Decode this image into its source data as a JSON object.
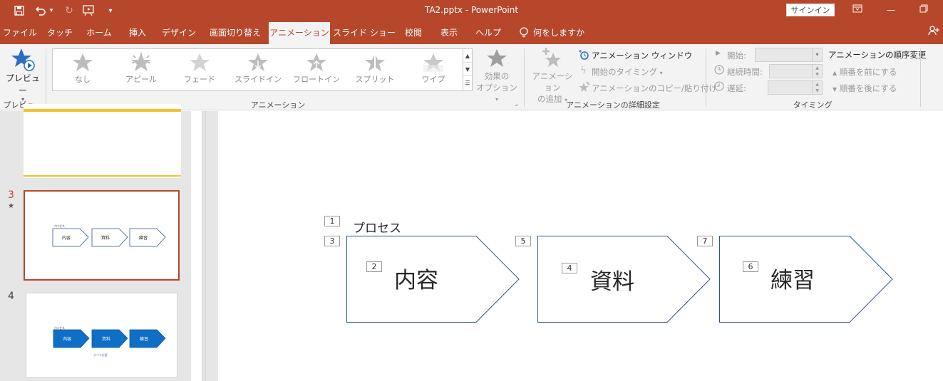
{
  "window": {
    "title": "TA2.pptx  -  PowerPoint",
    "signin_label": "サインイン"
  },
  "menu": {
    "tabs": [
      "ファイル",
      "タッチ",
      "ホーム",
      "挿入",
      "デザイン",
      "画面切り替え",
      "アニメーション",
      "スライド ショー",
      "校閲",
      "表示",
      "ヘルプ"
    ],
    "active_tab": "アニメーション",
    "tell_me": "何をしますか"
  },
  "ribbon": {
    "preview_label": "プレビュー",
    "preview_group_label": "プレビュー",
    "animation_group_label": "アニメーション",
    "gallery_items": [
      "なし",
      "アピール",
      "フェード",
      "スライドイン",
      "フロートイン",
      "スプリット",
      "ワイプ"
    ],
    "effect_options_line1": "効果の",
    "effect_options_line2": "オプション",
    "add_animation_line1": "アニメーション",
    "add_animation_line2": "の追加",
    "animation_pane": "アニメーション ウィンドウ",
    "trigger": "開始のタイミング",
    "animation_painter": "アニメーションのコピー/貼り付け",
    "advanced_group_label": "アニメーションの詳細設定",
    "start_label": "開始:",
    "duration_label": "継続時間:",
    "delay_label": "遅延:",
    "reorder_title": "アニメーションの順序変更",
    "move_earlier": "順番を前にする",
    "move_later": "順番を後にする",
    "timing_group_label": "タイミング"
  },
  "thumbnails": {
    "slide3_number": "3",
    "slide3_star": "★",
    "slide4_number": "4",
    "mini_title": "プロセス",
    "mini_boxes": [
      "内容",
      "資料",
      "練習"
    ],
    "mini_footer": "すべて必要"
  },
  "slide": {
    "title": "プロセス",
    "shapes": [
      "内容",
      "資料",
      "練習"
    ],
    "anim_tags": [
      "1",
      "2",
      "3",
      "4",
      "5",
      "6",
      "7"
    ]
  },
  "colors": {
    "accent": "#b7472a",
    "ribbon_bg": "#f3f3f3",
    "thumb_yellow": "#f2c12e",
    "shape_blue": "#0f6fc6"
  }
}
